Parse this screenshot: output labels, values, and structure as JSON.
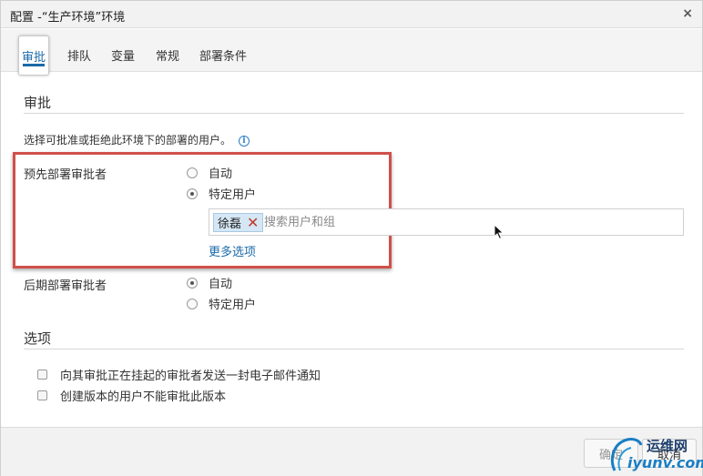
{
  "window": {
    "title": "配置 -“生产环境”环境",
    "close_symbol": "×"
  },
  "tabs": [
    {
      "label": "审批",
      "active": true
    },
    {
      "label": "排队",
      "active": false
    },
    {
      "label": "变量",
      "active": false
    },
    {
      "label": "常规",
      "active": false
    },
    {
      "label": "部署条件",
      "active": false
    }
  ],
  "approvals": {
    "heading": "审批",
    "description": "选择可批准或拒绝此环境下的部署的用户。",
    "info_icon": "info-icon",
    "pre_deployment": {
      "label": "预先部署审批者",
      "options": [
        {
          "label": "自动",
          "checked": false
        },
        {
          "label": "特定用户",
          "checked": true
        }
      ],
      "selected_user": "徐磊",
      "search_placeholder": "搜索用户和组",
      "more_options": "更多选项"
    },
    "post_deployment": {
      "label": "后期部署审批者",
      "options": [
        {
          "label": "自动",
          "checked": true
        },
        {
          "label": "特定用户",
          "checked": false
        }
      ]
    }
  },
  "options_section": {
    "heading": "选项",
    "items": [
      {
        "label": "向其审批正在挂起的审批者发送一封电子邮件通知",
        "checked": false
      },
      {
        "label": "创建版本的用户不能审批此版本",
        "checked": false
      }
    ]
  },
  "footer": {
    "ok_label": "确定",
    "cancel_label": "取消"
  },
  "watermark": {
    "cn": "运维网",
    "en": "iyunv.com"
  },
  "colors": {
    "accent": "#1a6aa8",
    "highlight_box": "#d0504a",
    "chip_bg": "#d5e7f5"
  }
}
